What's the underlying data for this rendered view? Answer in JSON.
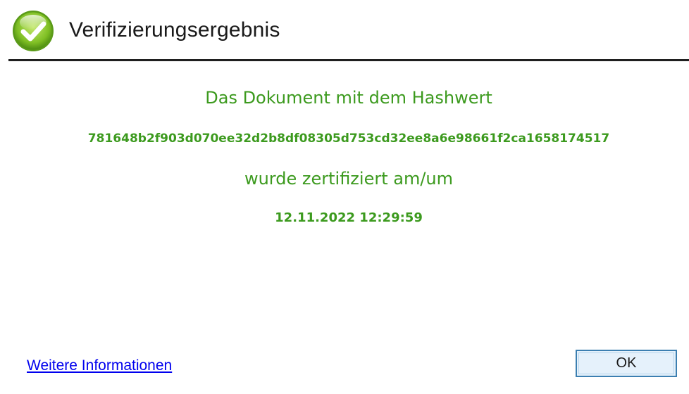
{
  "dialog": {
    "title": "Verifizierungsergebnis",
    "icon": "check-circle-icon",
    "accent_color": "#3c9a1e",
    "intro": "Das Dokument mit dem Hashwert",
    "hash": "781648b2f903d070ee32d2b8df08305d753cd32ee8a6e98661f2ca1658174517",
    "certified_label": "wurde zertifiziert am/um",
    "certified_datetime": "12.11.2022 12:29:59",
    "more_info_link": "Weitere Informationen",
    "ok_label": "OK"
  }
}
